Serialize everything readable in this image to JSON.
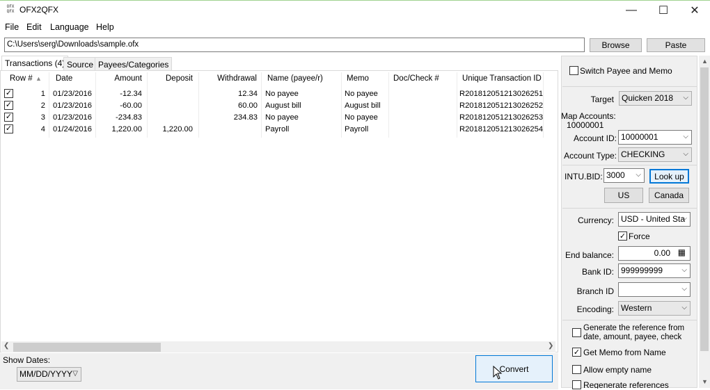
{
  "window": {
    "title": "OFX2QFX",
    "minimize": "—",
    "maximize": "☐",
    "close": "✕"
  },
  "menu": [
    "File",
    "Edit",
    "Language",
    "Help"
  ],
  "path": {
    "value": "C:\\Users\\serg\\Downloads\\sample.ofx"
  },
  "buttons": {
    "browse": "Browse",
    "paste": "Paste",
    "convert": "Convert",
    "lookup": "Look up",
    "us": "US",
    "canada": "Canada"
  },
  "tabs": [
    "Transactions (4)",
    "Source",
    "Payees/Categories"
  ],
  "table": {
    "columns": [
      "Row #",
      "Date",
      "Amount",
      "Deposit",
      "Withdrawal",
      "Name (payee/r)",
      "Memo",
      "Doc/Check #",
      "Unique Transaction ID"
    ],
    "rows": [
      {
        "checked": true,
        "row": "1",
        "date": "01/23/2016",
        "amount": "-12.34",
        "deposit": "",
        "withdrawal": "12.34",
        "name": "No payee",
        "memo": "No payee",
        "doc": "",
        "uid": "R201812051213026251"
      },
      {
        "checked": true,
        "row": "2",
        "date": "01/23/2016",
        "amount": "-60.00",
        "deposit": "",
        "withdrawal": "60.00",
        "name": "August bill",
        "memo": "August bill",
        "doc": "",
        "uid": "R201812051213026252"
      },
      {
        "checked": true,
        "row": "3",
        "date": "01/23/2016",
        "amount": "-234.83",
        "deposit": "",
        "withdrawal": "234.83",
        "name": "No payee",
        "memo": "No payee",
        "doc": "",
        "uid": "R201812051213026253"
      },
      {
        "checked": true,
        "row": "4",
        "date": "01/24/2016",
        "amount": "1,220.00",
        "deposit": "1,220.00",
        "withdrawal": "",
        "name": "Payroll",
        "memo": "Payroll",
        "doc": "",
        "uid": "R201812051213026254"
      }
    ]
  },
  "bottom": {
    "show_dates_label": "Show Dates:",
    "date_format": "MM/DD/YYYY"
  },
  "panel": {
    "switch_payee_memo": "Switch Payee and Memo",
    "target_label": "Target",
    "target_value": "Quicken 2018",
    "map_accounts_label": "Map Accounts:",
    "map_accounts_value": "10000001",
    "account_id_label": "Account ID:",
    "account_id_value": "10000001",
    "account_type_label": "Account Type:",
    "account_type_value": "CHECKING",
    "intubid_label": "INTU.BID:",
    "intubid_value": "3000",
    "currency_label": "Currency:",
    "currency_value": "USD - United Sta",
    "force_label": "Force",
    "end_balance_label": "End balance:",
    "end_balance_value": "0.00",
    "bank_id_label": "Bank ID:",
    "bank_id_value": "999999999",
    "branch_id_label": "Branch ID",
    "branch_id_value": "",
    "encoding_label": "Encoding:",
    "encoding_value": "Western",
    "gen_ref_label": "Generate the reference from date, amount, payee, check",
    "get_memo_label": "Get Memo from Name",
    "allow_empty_label": "Allow empty name",
    "regen_label": "Regenerate references"
  }
}
